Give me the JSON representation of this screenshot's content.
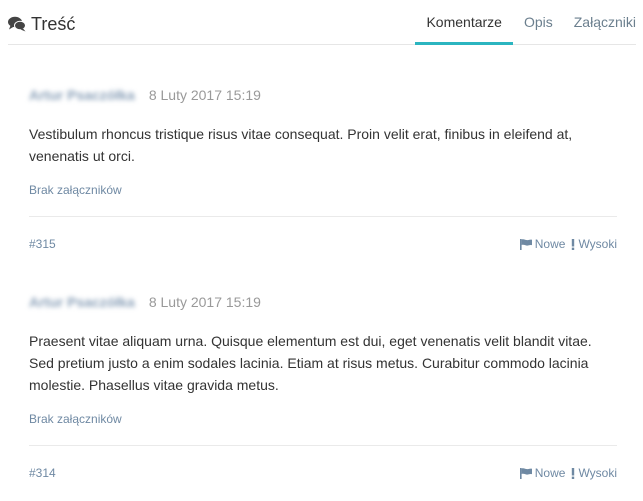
{
  "header": {
    "title": "Treść",
    "title_icon": "comments-icon",
    "tabs": [
      "Komentarze",
      "Opis",
      "Załączniki"
    ],
    "active_tab": "Komentarze"
  },
  "comments": [
    {
      "author": "Artur Psaczółka",
      "date": "8 Luty 2017 15:19",
      "text": "Vestibulum rhoncus tristique risus vitae consequat. Proin velit erat, finibus in eleifend at, venenatis ut orci.",
      "attachments": "Brak załączników",
      "ticket": "#315",
      "status": "Nowe",
      "priority": "Wysoki"
    },
    {
      "author": "Artur Psaczółka",
      "date": "8 Luty 2017 15:19",
      "text": "Praesent vitae aliquam urna. Quisque elementum est dui, eget venenatis velit blandit vitae. Sed pretium justo a enim sodales lacinia. Etiam at risus metus. Curabitur commodo lacinia molestie. Phasellus vitae gravida metus.",
      "attachments": "Brak załączników",
      "ticket": "#314",
      "status": "Nowe",
      "priority": "Wysoki"
    }
  ],
  "colors": {
    "accent": "#2bb5c0",
    "link": "#6f89a3"
  }
}
